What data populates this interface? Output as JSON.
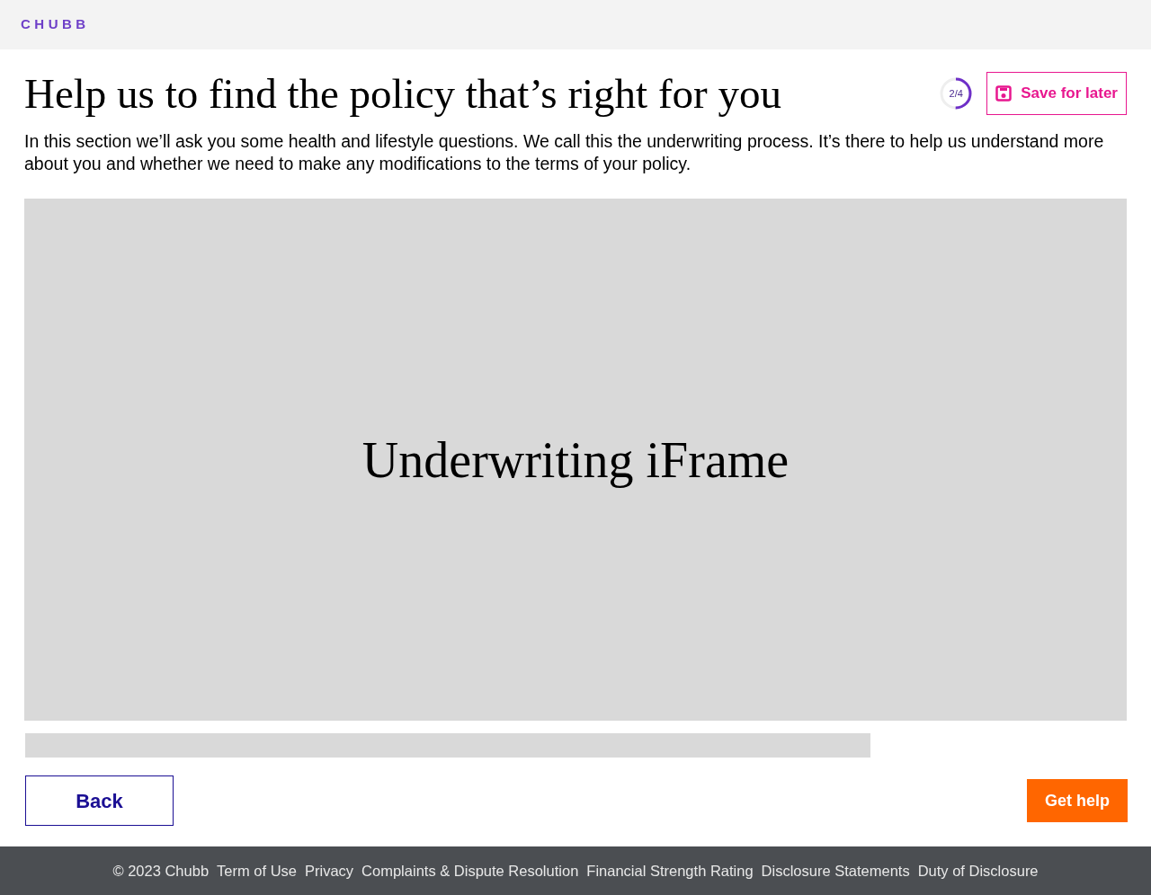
{
  "header": {
    "logo": "CHUBB"
  },
  "title": "Help us to find the policy that’s right for you",
  "progress": {
    "label": "2/4",
    "level": 0.5
  },
  "save_button": "Save for later",
  "intro": "In this section we’ll ask you some health and lifestyle questions. We call this the underwriting process. It’s there to help us understand more about you and whether we need to make any modifications to the terms of your policy.",
  "iframe": {
    "label": "Underwriting iFrame"
  },
  "buttons": {
    "back": "Back",
    "help": "Get help"
  },
  "footer": {
    "copyright": "© 2023 Chubb",
    "links": [
      "Term of Use",
      "Privacy",
      "Complaints & Dispute Resolution",
      "Financial Strength Rating",
      "Disclosure Statements",
      "Duty of Disclosure"
    ]
  }
}
